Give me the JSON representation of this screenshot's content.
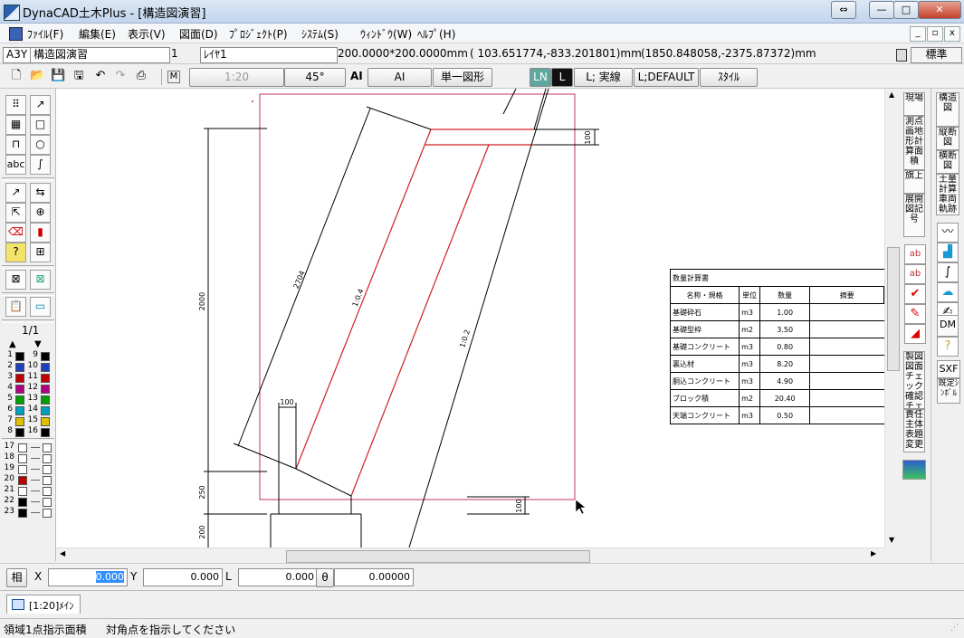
{
  "window": {
    "title": "DynaCAD土木Plus - [構造図演習]",
    "btn_restore": "⇔",
    "btn_min": "—",
    "btn_max": "□",
    "btn_close": "✕"
  },
  "menu": [
    "ﾌｧｲﾙ(F)",
    "編集(E)",
    "表示(V)",
    "図面(D)",
    "ﾌﾟﾛｼﾞｪｸﾄ(P)",
    "ｼｽﾃﾑ(S)",
    "ｳｨﾝﾄﾞｳ(W)",
    "ﾍﾙﾌﾟ(H)"
  ],
  "mdi": {
    "min": "_",
    "restore": "▫",
    "close": "x"
  },
  "info": {
    "paper": "A3Y",
    "drawing_name": "構造図演習",
    "layer_no": "1",
    "layer_name": "ﾚｲﾔ1",
    "grid": "200.0000*200.0000mm",
    "coord1": "( 103.651774,-833.201801)mm",
    "coord2": "(1850.848058,-2375.87372)mm",
    "mode": "標準"
  },
  "toolbar": {
    "m_label": "M",
    "scale": "1:20",
    "angle": "45°",
    "ai_label": "AI",
    "ai_button": "AI",
    "single_shape": "単一図形",
    "ln": "LN",
    "l": "L",
    "line_type": "L; 実線",
    "line_default": "L;DEFAULT",
    "style": "ｽﾀｲﾙ"
  },
  "left": {
    "page": "1/1",
    "text_tool": "abc",
    "colors": [
      {
        "n": "1",
        "c": "#000000"
      },
      {
        "n": "9",
        "c": "#000000"
      },
      {
        "n": "2",
        "c": "#1f3fbf"
      },
      {
        "n": "10",
        "c": "#1f3fbf"
      },
      {
        "n": "3",
        "c": "#c00000"
      },
      {
        "n": "11",
        "c": "#c00000"
      },
      {
        "n": "4",
        "c": "#b0007f"
      },
      {
        "n": "12",
        "c": "#b0007f"
      },
      {
        "n": "5",
        "c": "#00a000"
      },
      {
        "n": "13",
        "c": "#00a000"
      },
      {
        "n": "6",
        "c": "#00a0c0"
      },
      {
        "n": "14",
        "c": "#00a0c0"
      },
      {
        "n": "7",
        "c": "#e0c000"
      },
      {
        "n": "15",
        "c": "#e0c000"
      },
      {
        "n": "8",
        "c": "#000000"
      },
      {
        "n": "16",
        "c": "#000000"
      }
    ],
    "layers": [
      {
        "n": "17",
        "c": "#ffffff"
      },
      {
        "n": "18",
        "c": "#ffffff"
      },
      {
        "n": "19",
        "c": "#ffffff"
      },
      {
        "n": "20",
        "c": "#c00000"
      },
      {
        "n": "21",
        "c": "#ffffff"
      },
      {
        "n": "22",
        "c": "#000000"
      },
      {
        "n": "23",
        "c": "#000000"
      }
    ]
  },
  "right1": {
    "b1": "現場",
    "b2": "測点画地形計算面積",
    "b3": "旗上",
    "b4": "展開図記号",
    "b5": "製図図面チェック確認チェック",
    "b6": "責任主体表題変更"
  },
  "right2": {
    "b1": "構造図",
    "b2": "縦断図",
    "b3": "横断図",
    "b4": "土量計算車両軌跡",
    "dm": "DM",
    "sxf": "SXF",
    "preset": "既定ｼﾝﾎﾞﾙ"
  },
  "drawing": {
    "dims": {
      "d100_top": "100",
      "d2704": "2704",
      "d2000": "2000",
      "slope1": "1:0.4",
      "slope2": "1:0.2",
      "d100_small": "100",
      "d250": "250",
      "d200": "200",
      "d100_right": "100"
    }
  },
  "table": {
    "title": "数量計算書",
    "headers": [
      "名称・規格",
      "単位",
      "数量",
      "摘要"
    ],
    "rows": [
      [
        "基礎砕石",
        "m3",
        "1.00",
        ""
      ],
      [
        "基礎型枠",
        "m2",
        "3.50",
        ""
      ],
      [
        "基礎コンクリート",
        "m3",
        "0.80",
        ""
      ],
      [
        "裏込材",
        "m3",
        "8.20",
        ""
      ],
      [
        "胴込コンクリート",
        "m3",
        "4.90",
        ""
      ],
      [
        "ブロック積",
        "m2",
        "20.40",
        ""
      ],
      [
        "天端コンクリート",
        "m3",
        "0.50",
        ""
      ]
    ]
  },
  "coords": {
    "mode": "相",
    "x_label": "X",
    "x": "0.000",
    "y_label": "Y",
    "y": "0.000",
    "l_label": "L",
    "l": "0.000",
    "theta_label": "θ",
    "theta": "0.00000"
  },
  "tab": {
    "label": "[1:20]ﾒｲﾝ"
  },
  "status": {
    "mode": "領域1点指示面積",
    "message": "対角点を指示してください"
  }
}
